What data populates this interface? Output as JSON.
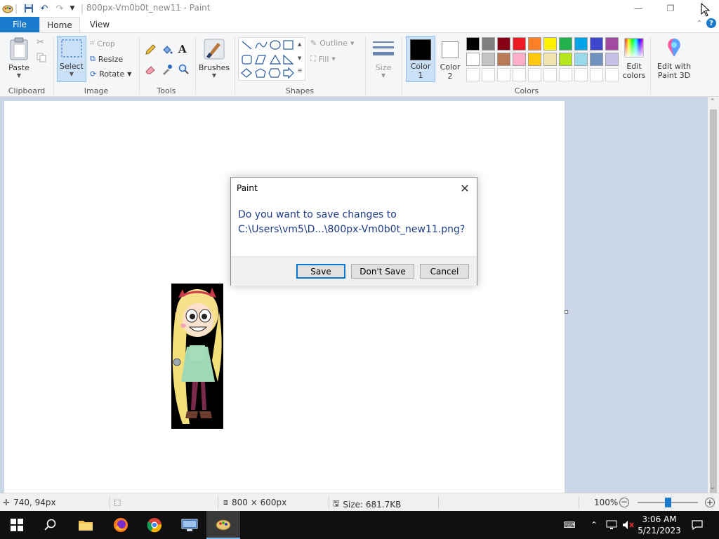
{
  "window": {
    "title": "800px-Vm0b0t_new11 - Paint"
  },
  "tabs": [
    {
      "label": "File"
    },
    {
      "label": "Home"
    },
    {
      "label": "View"
    }
  ],
  "ribbon": {
    "clipboard": {
      "paste": "Paste",
      "group": "Clipboard"
    },
    "image": {
      "select": "Select",
      "crop": "Crop",
      "resize": "Resize",
      "rotate": "Rotate",
      "group": "Image"
    },
    "tools": {
      "group": "Tools"
    },
    "brushes": {
      "label": "Brushes"
    },
    "shapes": {
      "outline": "Outline",
      "fill": "Fill",
      "group": "Shapes"
    },
    "size": {
      "label": "Size"
    },
    "colors": {
      "color1_label": "Color",
      "color1_num": "1",
      "color2_label": "Color",
      "color2_num": "2",
      "edit_label": "Edit",
      "edit_label2": "colors",
      "paint3d_label": "Edit with",
      "paint3d_label2": "Paint 3D",
      "group": "Colors",
      "color1": "#000000",
      "color2": "#ffffff",
      "palette_row1": [
        "#000000",
        "#7f7f7f",
        "#880015",
        "#ed1c24",
        "#ff7f27",
        "#fff200",
        "#22b14c",
        "#00a2e8",
        "#3f48cc",
        "#a349a4"
      ],
      "palette_row2": [
        "#ffffff",
        "#c3c3c3",
        "#b97a57",
        "#ffaec9",
        "#ffc90e",
        "#efe4b0",
        "#b5e61d",
        "#99d9ea",
        "#7092be",
        "#c8bfe7"
      ]
    }
  },
  "dialog": {
    "title": "Paint",
    "message_line1": "Do you want to save changes to",
    "message_line2": "C:\\Users\\vm5\\D...\\800px-Vm0b0t_new11.png?",
    "buttons": {
      "save": "Save",
      "dont_save": "Don't Save",
      "cancel": "Cancel"
    }
  },
  "statusbar": {
    "cursor_pos": "740, 94px",
    "dimensions": "800 × 600px",
    "size": "Size: 681.7KB",
    "zoom": "100%",
    "zoom_level": 0.5
  },
  "taskbar": {
    "time": "3:06 AM",
    "date": "5/21/2023"
  }
}
